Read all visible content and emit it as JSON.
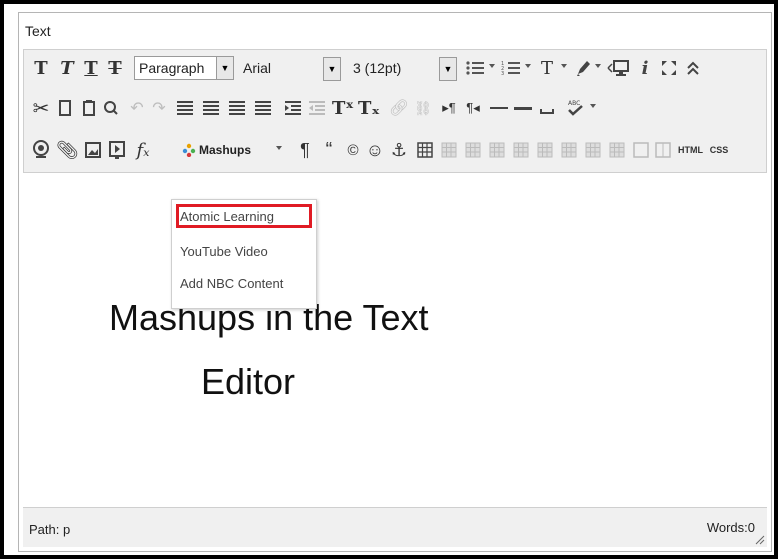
{
  "editor": {
    "field_label": "Text",
    "toolbar": {
      "row1": {
        "format_value": "Paragraph",
        "font_value": "Arial",
        "size_value": "3 (12pt)"
      },
      "row3": {
        "mashups_label": "Mashups",
        "html_label": "HTML",
        "css_label": "CSS"
      }
    },
    "mashups_menu": {
      "items": [
        "Atomic Learning",
        "YouTube Video",
        "Add NBC Content"
      ],
      "highlighted_item": "Atomic Learning"
    },
    "content": {
      "line1": "Mashups in the Text",
      "line2": "Editor"
    },
    "status": {
      "path_label": "Path: p",
      "words_label": "Words:0"
    }
  }
}
